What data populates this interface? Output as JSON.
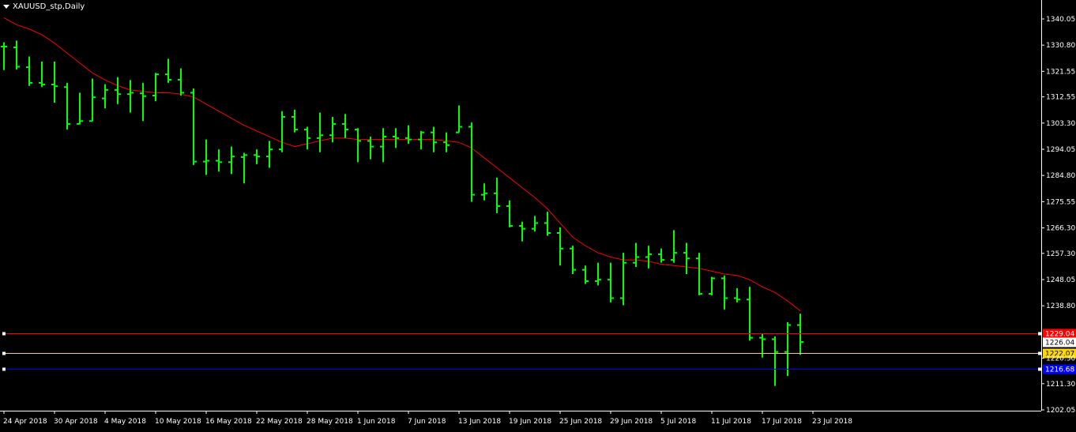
{
  "window": {
    "title": "XAUUSD_stp,Daily"
  },
  "colors": {
    "background": "#000000",
    "foreground": "#ffffff",
    "bar": "#00ff00",
    "ma": "#ff0000",
    "line_red": "#ff0000",
    "line_yellow": "#ffd700",
    "line_blue": "#0000ff",
    "line_current": "#ffffff"
  },
  "chart_data": {
    "type": "ohlc",
    "symbol": "XAUUSD_stp",
    "timeframe": "Daily",
    "ylim": [
      1200.0,
      1345.0
    ],
    "y_ticks": [
      "1340.05",
      "1330.80",
      "1321.55",
      "1312.55",
      "1303.30",
      "1294.05",
      "1284.80",
      "1275.55",
      "1266.30",
      "1257.30",
      "1248.05",
      "1238.80",
      "1220.30",
      "1211.30",
      "1202.05"
    ],
    "x_ticks": [
      {
        "label": "24 Apr 2018",
        "index": 0
      },
      {
        "label": "30 Apr 2018",
        "index": 4
      },
      {
        "label": "4 May 2018",
        "index": 8
      },
      {
        "label": "10 May 2018",
        "index": 12
      },
      {
        "label": "16 May 2018",
        "index": 16
      },
      {
        "label": "22 May 2018",
        "index": 20
      },
      {
        "label": "28 May 2018",
        "index": 24
      },
      {
        "label": "1 Jun 2018",
        "index": 28
      },
      {
        "label": "7 Jun 2018",
        "index": 32
      },
      {
        "label": "13 Jun 2018",
        "index": 36
      },
      {
        "label": "19 Jun 2018",
        "index": 40
      },
      {
        "label": "25 Jun 2018",
        "index": 44
      },
      {
        "label": "29 Jun 2018",
        "index": 48
      },
      {
        "label": "5 Jul 2018",
        "index": 52
      },
      {
        "label": "11 Jul 2018",
        "index": 56
      },
      {
        "label": "17 Jul 2018",
        "index": 60
      },
      {
        "label": "23 Jul 2018",
        "index": 64
      }
    ],
    "bars": [
      {
        "o": 1330.3,
        "h": 1331.8,
        "l": 1322.0,
        "c": 1330.3
      },
      {
        "o": 1330.0,
        "h": 1332.4,
        "l": 1322.2,
        "c": 1323.2
      },
      {
        "o": 1323.0,
        "h": 1326.8,
        "l": 1316.4,
        "c": 1317.5
      },
      {
        "o": 1317.5,
        "h": 1325.0,
        "l": 1316.0,
        "c": 1316.9
      },
      {
        "o": 1316.9,
        "h": 1325.0,
        "l": 1310.5,
        "c": 1316.3
      },
      {
        "o": 1316.0,
        "h": 1317.5,
        "l": 1301.0,
        "c": 1303.0
      },
      {
        "o": 1303.0,
        "h": 1314.0,
        "l": 1302.8,
        "c": 1304.0
      },
      {
        "o": 1304.0,
        "h": 1319.0,
        "l": 1304.0,
        "c": 1312.4
      },
      {
        "o": 1312.0,
        "h": 1317.0,
        "l": 1308.5,
        "c": 1315.0
      },
      {
        "o": 1315.0,
        "h": 1319.5,
        "l": 1310.0,
        "c": 1313.5
      },
      {
        "o": 1313.5,
        "h": 1318.5,
        "l": 1307.0,
        "c": 1314.0
      },
      {
        "o": 1313.8,
        "h": 1317.5,
        "l": 1304.0,
        "c": 1312.8
      },
      {
        "o": 1313.0,
        "h": 1321.0,
        "l": 1311.0,
        "c": 1320.5
      },
      {
        "o": 1320.5,
        "h": 1326.0,
        "l": 1317.5,
        "c": 1318.6
      },
      {
        "o": 1318.6,
        "h": 1322.6,
        "l": 1313.0,
        "c": 1314.0
      },
      {
        "o": 1314.0,
        "h": 1315.5,
        "l": 1288.5,
        "c": 1289.7
      },
      {
        "o": 1289.7,
        "h": 1297.5,
        "l": 1285.0,
        "c": 1290.0
      },
      {
        "o": 1290.0,
        "h": 1294.0,
        "l": 1286.2,
        "c": 1289.5
      },
      {
        "o": 1289.5,
        "h": 1295.0,
        "l": 1285.3,
        "c": 1291.5
      },
      {
        "o": 1291.3,
        "h": 1292.8,
        "l": 1282.0,
        "c": 1292.0
      },
      {
        "o": 1292.0,
        "h": 1294.0,
        "l": 1288.8,
        "c": 1291.5
      },
      {
        "o": 1291.5,
        "h": 1297.0,
        "l": 1287.5,
        "c": 1294.0
      },
      {
        "o": 1294.0,
        "h": 1307.5,
        "l": 1293.0,
        "c": 1305.5
      },
      {
        "o": 1305.5,
        "h": 1308.0,
        "l": 1300.0,
        "c": 1301.0
      },
      {
        "o": 1301.0,
        "h": 1302.0,
        "l": 1294.0,
        "c": 1298.0
      },
      {
        "o": 1298.0,
        "h": 1307.0,
        "l": 1293.0,
        "c": 1299.0
      },
      {
        "o": 1299.0,
        "h": 1305.5,
        "l": 1296.5,
        "c": 1303.0
      },
      {
        "o": 1303.0,
        "h": 1306.5,
        "l": 1298.0,
        "c": 1301.0
      },
      {
        "o": 1301.0,
        "h": 1301.5,
        "l": 1289.5,
        "c": 1297.0
      },
      {
        "o": 1297.0,
        "h": 1298.5,
        "l": 1290.5,
        "c": 1295.0
      },
      {
        "o": 1295.0,
        "h": 1301.5,
        "l": 1289.5,
        "c": 1298.5
      },
      {
        "o": 1298.5,
        "h": 1301.5,
        "l": 1294.5,
        "c": 1298.0
      },
      {
        "o": 1298.0,
        "h": 1302.5,
        "l": 1296.0,
        "c": 1297.5
      },
      {
        "o": 1297.5,
        "h": 1300.5,
        "l": 1294.0,
        "c": 1300.0
      },
      {
        "o": 1300.0,
        "h": 1302.0,
        "l": 1293.0,
        "c": 1296.5
      },
      {
        "o": 1296.5,
        "h": 1300.0,
        "l": 1293.0,
        "c": 1295.5
      },
      {
        "o": 1300.0,
        "h": 1309.5,
        "l": 1300.0,
        "c": 1302.0
      },
      {
        "o": 1302.0,
        "h": 1303.5,
        "l": 1275.5,
        "c": 1278.0
      },
      {
        "o": 1278.0,
        "h": 1282.0,
        "l": 1276.0,
        "c": 1278.5
      },
      {
        "o": 1278.5,
        "h": 1284.0,
        "l": 1271.5,
        "c": 1274.0
      },
      {
        "o": 1274.0,
        "h": 1276.0,
        "l": 1266.5,
        "c": 1267.0
      },
      {
        "o": 1267.0,
        "h": 1268.5,
        "l": 1261.5,
        "c": 1266.0
      },
      {
        "o": 1266.0,
        "h": 1270.5,
        "l": 1265.0,
        "c": 1268.0
      },
      {
        "o": 1268.0,
        "h": 1272.0,
        "l": 1263.5,
        "c": 1264.5
      },
      {
        "o": 1264.5,
        "h": 1266.5,
        "l": 1253.0,
        "c": 1259.0
      },
      {
        "o": 1259.0,
        "h": 1260.0,
        "l": 1250.0,
        "c": 1251.5
      },
      {
        "o": 1251.5,
        "h": 1253.0,
        "l": 1246.5,
        "c": 1247.5
      },
      {
        "o": 1247.5,
        "h": 1254.0,
        "l": 1246.0,
        "c": 1248.0
      },
      {
        "o": 1248.0,
        "h": 1254.0,
        "l": 1240.0,
        "c": 1241.5
      },
      {
        "o": 1241.5,
        "h": 1257.5,
        "l": 1239.0,
        "c": 1254.0
      },
      {
        "o": 1254.0,
        "h": 1261.0,
        "l": 1252.5,
        "c": 1256.0
      },
      {
        "o": 1256.0,
        "h": 1260.0,
        "l": 1252.0,
        "c": 1257.0
      },
      {
        "o": 1257.0,
        "h": 1259.0,
        "l": 1254.0,
        "c": 1255.0
      },
      {
        "o": 1255.0,
        "h": 1265.5,
        "l": 1254.0,
        "c": 1257.5
      },
      {
        "o": 1257.5,
        "h": 1261.0,
        "l": 1250.0,
        "c": 1255.5
      },
      {
        "o": 1255.5,
        "h": 1257.5,
        "l": 1242.5,
        "c": 1243.0
      },
      {
        "o": 1243.0,
        "h": 1249.0,
        "l": 1242.5,
        "c": 1248.5
      },
      {
        "o": 1248.5,
        "h": 1249.5,
        "l": 1237.5,
        "c": 1241.5
      },
      {
        "o": 1241.5,
        "h": 1245.0,
        "l": 1240.0,
        "c": 1241.0
      },
      {
        "o": 1241.0,
        "h": 1245.5,
        "l": 1226.5,
        "c": 1227.5
      },
      {
        "o": 1227.5,
        "h": 1229.0,
        "l": 1220.5,
        "c": 1227.0
      },
      {
        "o": 1227.0,
        "h": 1228.0,
        "l": 1210.5,
        "c": 1222.5
      },
      {
        "o": 1222.5,
        "h": 1233.0,
        "l": 1214.0,
        "c": 1232.0
      },
      {
        "o": 1232.0,
        "h": 1236.0,
        "l": 1221.5,
        "c": 1226.0
      }
    ],
    "ma": [
      1340.5,
      1338.0,
      1336.5,
      1334.5,
      1331.5,
      1328.0,
      1324.5,
      1321.0,
      1318.5,
      1316.5,
      1315.0,
      1314.5,
      1314.0,
      1314.0,
      1313.5,
      1312.5,
      1310.0,
      1307.5,
      1305.0,
      1302.5,
      1300.5,
      1298.5,
      1296.5,
      1295.0,
      1296.0,
      1297.0,
      1298.0,
      1298.0,
      1297.5,
      1297.5,
      1297.5,
      1297.5,
      1297.5,
      1297.5,
      1297.5,
      1297.0,
      1296.5,
      1294.5,
      1291.0,
      1287.5,
      1284.0,
      1280.5,
      1277.0,
      1273.0,
      1268.0,
      1263.0,
      1260.0,
      1257.5,
      1256.0,
      1255.0,
      1255.0,
      1254.5,
      1253.5,
      1253.0,
      1252.5,
      1252.0,
      1251.0,
      1250.0,
      1249.5,
      1248.0,
      1245.5,
      1243.5,
      1240.5,
      1237.0
    ],
    "hlines": [
      {
        "name": "red",
        "price": "1229.04",
        "value": 1229.04
      },
      {
        "name": "current",
        "price": "1226.04",
        "value": 1226.04
      },
      {
        "name": "yellow",
        "price": "1222.07",
        "value": 1222.07
      },
      {
        "name": "blue",
        "price": "1216.68",
        "value": 1216.68
      }
    ]
  }
}
